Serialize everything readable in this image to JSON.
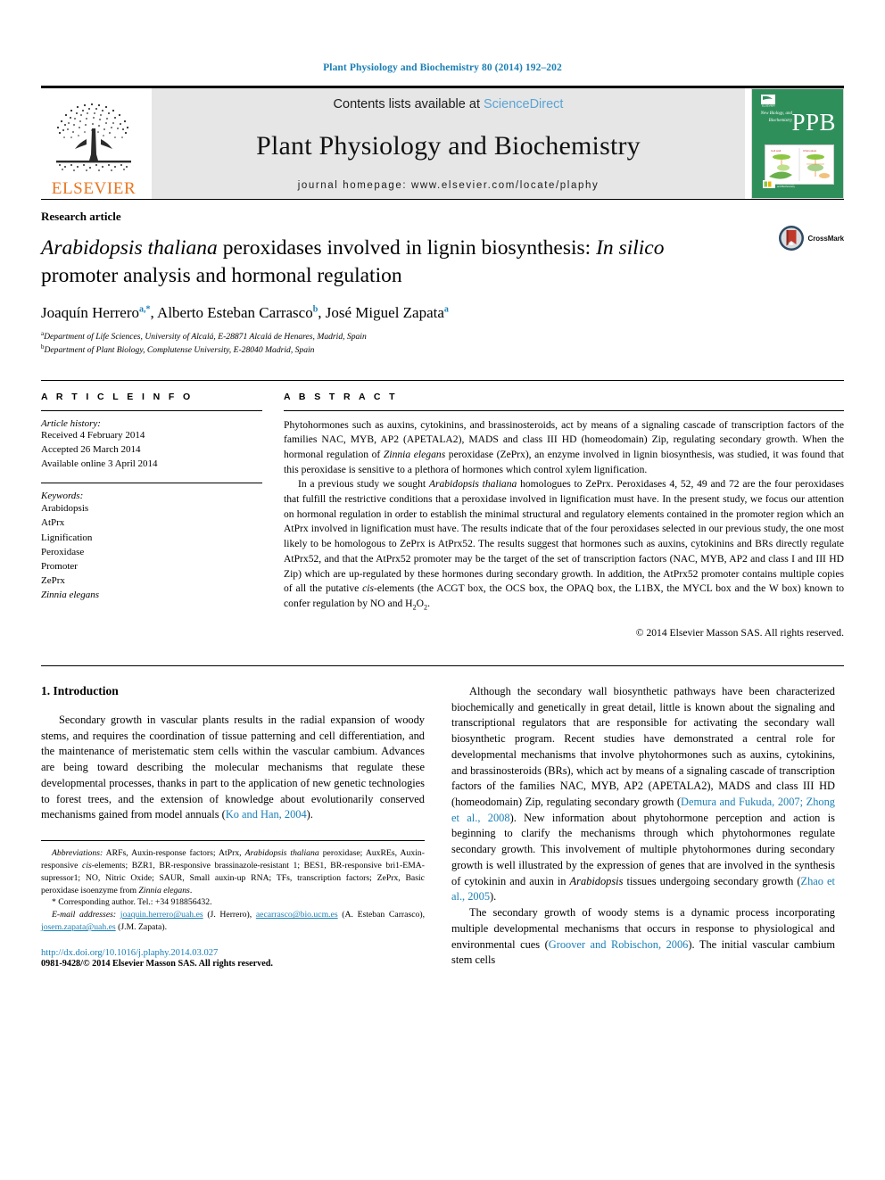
{
  "running_head": "Plant Physiology and Biochemistry 80 (2014) 192–202",
  "masthead": {
    "contents_prefix": "Contents lists available at ",
    "sciencedirect": "ScienceDirect",
    "journal_name": "Plant Physiology and Biochemistry",
    "homepage": "journal homepage: www.elsevier.com/locate/plaphy",
    "publisher_wordmark": "ELSEVIER",
    "cover_title": "PPB",
    "cover_subtitle": "New Biology, and Biochemistry"
  },
  "title_block": {
    "article_type": "Research article",
    "title_part1_italic": "Arabidopsis thaliana",
    "title_part2": " peroxidases involved in lignin biosynthesis: ",
    "title_part3_italic": "In silico",
    "title_part4": " promoter analysis and hormonal regulation",
    "crossmark_label": "CrossMark",
    "authors_html": "Joaquín Herrero, Alberto Esteban Carrasco, José Miguel Zapata",
    "affiliation_a": "Department of Life Sciences, University of Alcalá, E-28871 Alcalá de Henares, Madrid, Spain",
    "affiliation_b": "Department of Plant Biology, Complutense University, E-28040 Madrid, Spain"
  },
  "article_info": {
    "heading": "A R T I C L E  I N F O",
    "history_label": "Article history:",
    "history": [
      "Received 4 February 2014",
      "Accepted 26 March 2014",
      "Available online 3 April 2014"
    ],
    "keywords_label": "Keywords:",
    "keywords": [
      "Arabidopsis",
      "AtPrx",
      "Lignification",
      "Peroxidase",
      "Promoter",
      "ZePrx",
      "Zinnia elegans"
    ]
  },
  "abstract": {
    "heading": "A B S T R A C T",
    "copyright": "© 2014 Elsevier Masson SAS. All rights reserved."
  },
  "introduction": {
    "heading": "1.  Introduction"
  },
  "footnotes": {
    "abbrev_label": "Abbreviations:",
    "corresponding_star": "*",
    "corresponding": "Corresponding author. Tel.: +34 918856432.",
    "email_label": "E-mail addresses:",
    "email1": "joaquin.herrero@uah.es",
    "email1_who": " (J. Herrero), ",
    "email2": "aecarrasco@bio.ucm.es",
    "email2_who": "(A. Esteban Carrasco), ",
    "email3": "josem.zapata@uah.es",
    "email3_who": " (J.M. Zapata).",
    "doi": "http://dx.doi.org/10.1016/j.plaphy.2014.03.027",
    "issn": "0981-9428/© 2014 Elsevier Masson SAS. All rights reserved."
  },
  "colors": {
    "link": "#1a7fb5",
    "sciencedirect": "#5BA4D4",
    "elsevier_orange": "#E87722",
    "cover_green": "#2f8f5b",
    "masthead_grey": "#e6e6e6"
  }
}
